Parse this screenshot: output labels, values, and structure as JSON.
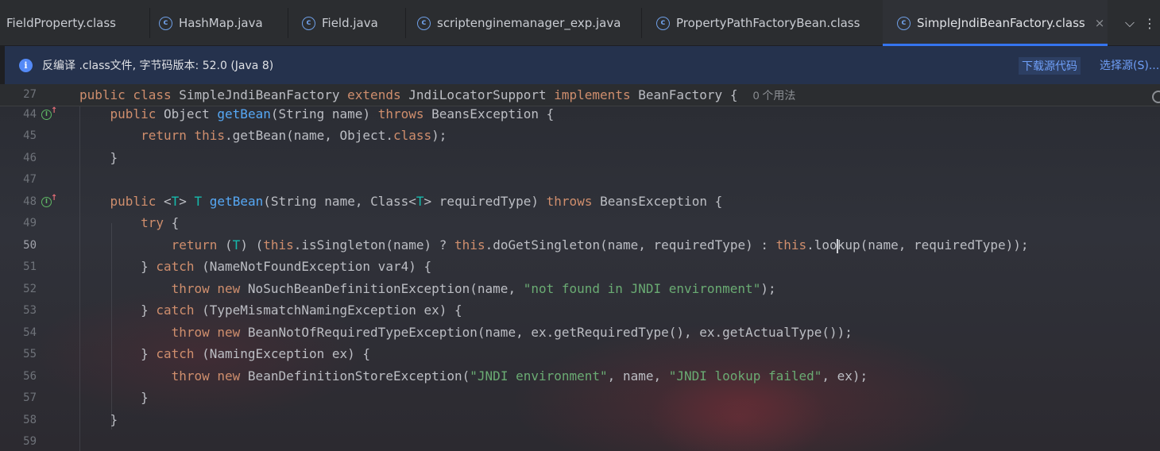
{
  "tabs": [
    {
      "label": "FieldProperty.class",
      "icon": "class-icon"
    },
    {
      "label": "HashMap.java",
      "icon": "class-icon"
    },
    {
      "label": "Field.java",
      "icon": "class-icon"
    },
    {
      "label": "scriptenginemanager_exp.java",
      "icon": "class-icon"
    },
    {
      "label": "PropertyPathFactoryBean.class",
      "icon": "class-icon"
    },
    {
      "label": "SimpleJndiBeanFactory.class",
      "icon": "class-icon",
      "active": true
    }
  ],
  "tab_close": "×",
  "tab_dropdown": "⌵",
  "tab_more": "⋮",
  "infobar": {
    "icon": "i",
    "message": "反编译 .class文件, 字节码版本: 52.0 (Java 8)",
    "download_link": "下载源代码",
    "choose_link": "选择源(S)..."
  },
  "sticky": {
    "line_number": "27",
    "usages_hint": "0 个用法"
  },
  "line_numbers": [
    "44",
    "45",
    "46",
    "47",
    "48",
    "49",
    "50",
    "51",
    "52",
    "53",
    "54",
    "55",
    "56",
    "57",
    "58",
    "59"
  ],
  "colors": {
    "keyword": "#cf8e6d",
    "method": "#56a8f5",
    "type_param": "#16baac",
    "string": "#6aab73",
    "accent": "#3574f0"
  }
}
